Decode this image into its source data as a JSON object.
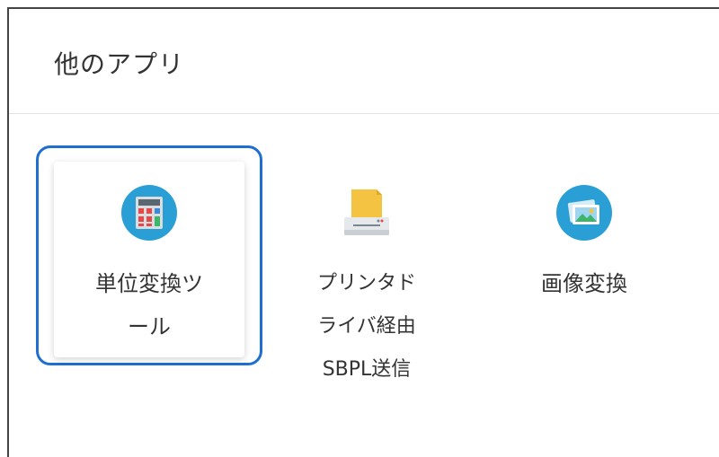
{
  "header": {
    "title": "他のアプリ"
  },
  "apps": [
    {
      "label": "単位変換ツ\nール",
      "icon": "calculator-icon",
      "selected": true
    },
    {
      "label": "プリンタド\nライバ経由\nSBPL送信",
      "icon": "printer-icon",
      "selected": false
    },
    {
      "label": "画像変換",
      "icon": "image-icon",
      "selected": false
    }
  ],
  "colors": {
    "focus": "#1e6fd0",
    "icon_circle": "#2a9fd6",
    "printer_paper": "#f5c342"
  }
}
